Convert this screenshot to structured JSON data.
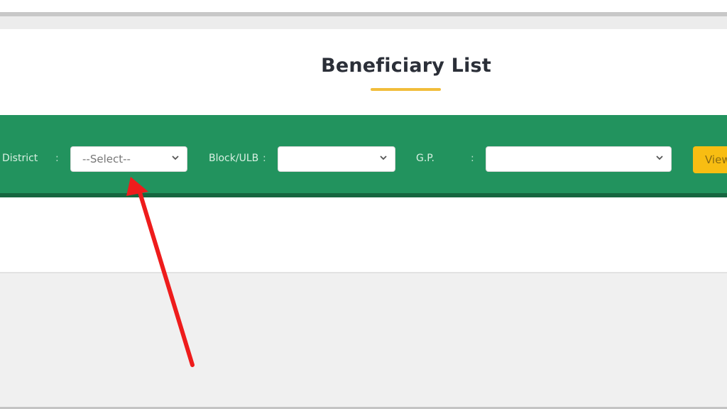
{
  "page": {
    "title": "Beneficiary List",
    "accent_color": "#f1bd3b",
    "filter_bar_color": "#22935e"
  },
  "filters": {
    "district": {
      "label": "District",
      "separator": ":",
      "value": "--Select--"
    },
    "block_ulb": {
      "label": "Block/ULB",
      "separator": ":",
      "value": ""
    },
    "gp": {
      "label": "G.P.",
      "separator": ":",
      "value": ""
    },
    "view_button": {
      "label": "View"
    }
  },
  "annotation": {
    "type": "red-arrow",
    "points_to": "district-select",
    "color": "#ee1c1c"
  }
}
